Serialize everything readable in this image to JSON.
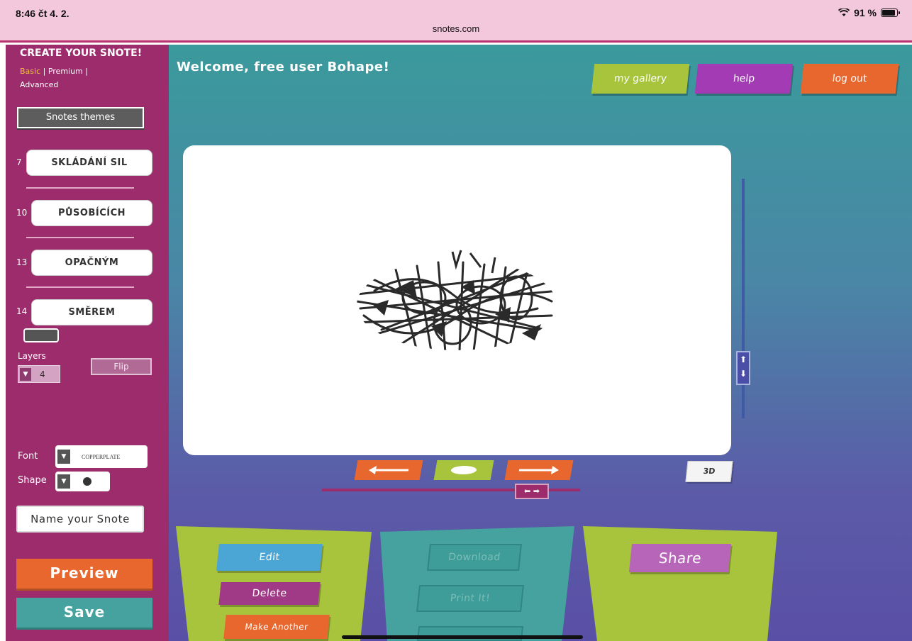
{
  "status": {
    "time": "8:46  čt 4. 2.",
    "url": "snotes.com",
    "battery": "91 %",
    "battery_level": 0.91
  },
  "sidebar": {
    "title": "CREATE YOUR SNOTE!",
    "tier_basic": "Basic",
    "tier_premium": "Premium",
    "tier_advanced": "Advanced",
    "themes_button": "Snotes themes",
    "words": [
      {
        "num": "7",
        "text": "SKLÁDÁNÍ SIL"
      },
      {
        "num": "10",
        "text": "PŮSOBÍCÍCH"
      },
      {
        "num": "13",
        "text": "OPAČNÝM"
      },
      {
        "num": "14",
        "text": "SMĚREM"
      }
    ],
    "layers_label": "Layers",
    "layers_value": "4",
    "flip_label": "Flip",
    "font_label": "Font",
    "font_value": "COPPERPLATE",
    "shape_label": "Shape",
    "name_placeholder": "Name your Snote",
    "preview_label": "Preview",
    "save_label": "Save"
  },
  "header": {
    "welcome": "Welcome, free user Bohape!",
    "gallery_label": "my gallery",
    "help_label": "help",
    "logout_label": "log out"
  },
  "controls": {
    "three_d": "3D"
  },
  "panels": {
    "edit_label": "Edit",
    "delete_label": "Delete",
    "make_another_label": "Make Another",
    "download_label": "Download",
    "print_label": "Print It!",
    "share_label": "Share"
  },
  "colors": {
    "sidebar": "#9c2c6c",
    "green": "#a8c43c",
    "orange": "#e8672e",
    "purple": "#a33bb5",
    "teal": "#45a29e",
    "blue": "#4ba6d6"
  }
}
